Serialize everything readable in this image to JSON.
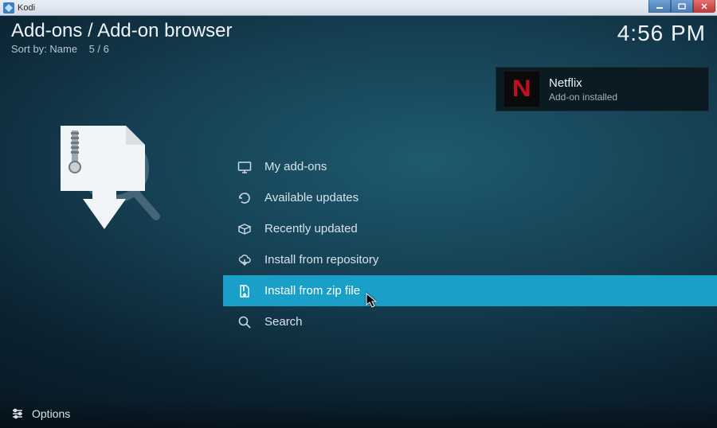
{
  "window": {
    "title": "Kodi"
  },
  "header": {
    "breadcrumb": "Add-ons / Add-on browser",
    "sort_by_label": "Sort by:",
    "sort_by_value": "Name",
    "position": "5 / 6"
  },
  "clock": "4:56 PM",
  "notification": {
    "icon_letter": "N",
    "title": "Netflix",
    "subtitle": "Add-on installed"
  },
  "menu": {
    "items": [
      {
        "id": "my-addons",
        "label": "My add-ons",
        "selected": false
      },
      {
        "id": "available-updates",
        "label": "Available updates",
        "selected": false
      },
      {
        "id": "recently-updated",
        "label": "Recently updated",
        "selected": false
      },
      {
        "id": "install-from-repository",
        "label": "Install from repository",
        "selected": false
      },
      {
        "id": "install-from-zip-file",
        "label": "Install from zip file",
        "selected": true
      },
      {
        "id": "search",
        "label": "Search",
        "selected": false
      }
    ]
  },
  "footer": {
    "options_label": "Options"
  }
}
